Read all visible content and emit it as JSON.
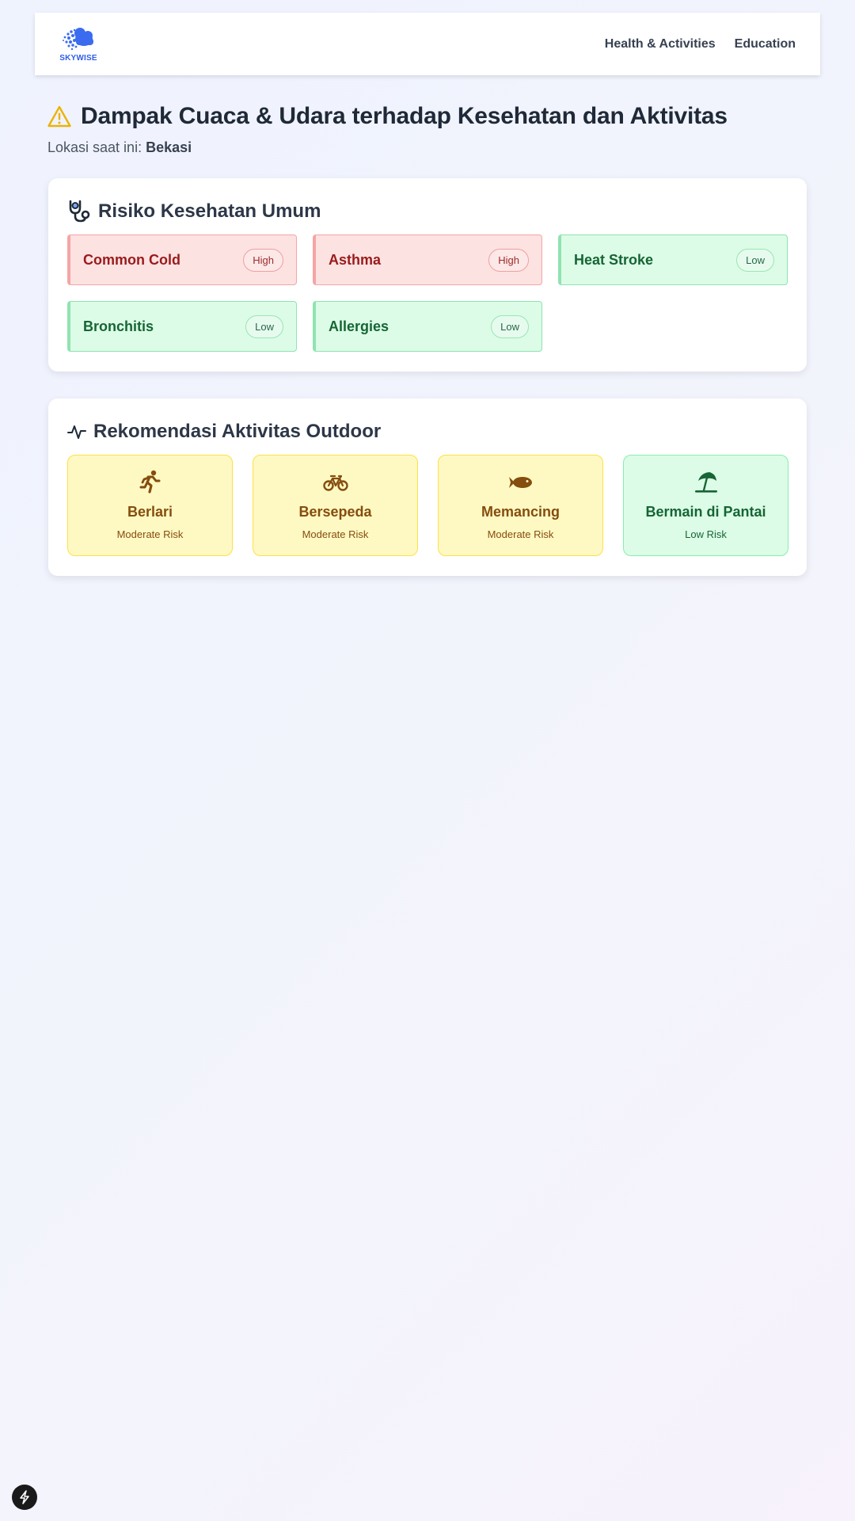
{
  "navbar": {
    "logo_text": "SKYWISE",
    "links": [
      "Health & Activities",
      "Education"
    ]
  },
  "header": {
    "title": "Dampak Cuaca & Udara terhadap Kesehatan dan Aktivitas",
    "location_label": "Lokasi saat ini:",
    "location_value": "Bekasi"
  },
  "health": {
    "title": "Risiko Kesehatan Umum",
    "items": [
      {
        "name": "Common Cold",
        "level": "High"
      },
      {
        "name": "Asthma",
        "level": "High"
      },
      {
        "name": "Heat Stroke",
        "level": "Low"
      },
      {
        "name": "Bronchitis",
        "level": "Low"
      },
      {
        "name": "Allergies",
        "level": "Low"
      }
    ]
  },
  "activities": {
    "title": "Rekomendasi Aktivitas Outdoor",
    "items": [
      {
        "name": "Berlari",
        "risk": "Moderate Risk",
        "icon": "running-icon"
      },
      {
        "name": "Bersepeda",
        "risk": "Moderate Risk",
        "icon": "bicycle-icon"
      },
      {
        "name": "Memancing",
        "risk": "Moderate Risk",
        "icon": "fish-icon"
      },
      {
        "name": "Bermain di Pantai",
        "risk": "Low Risk",
        "icon": "umbrella-beach-icon"
      }
    ]
  },
  "colors": {
    "brand": "#2f5bea",
    "high_bg": "#fde2e2",
    "low_bg": "#dcfce7",
    "moderate_bg": "#fef9c3",
    "warning": "#eab308"
  }
}
